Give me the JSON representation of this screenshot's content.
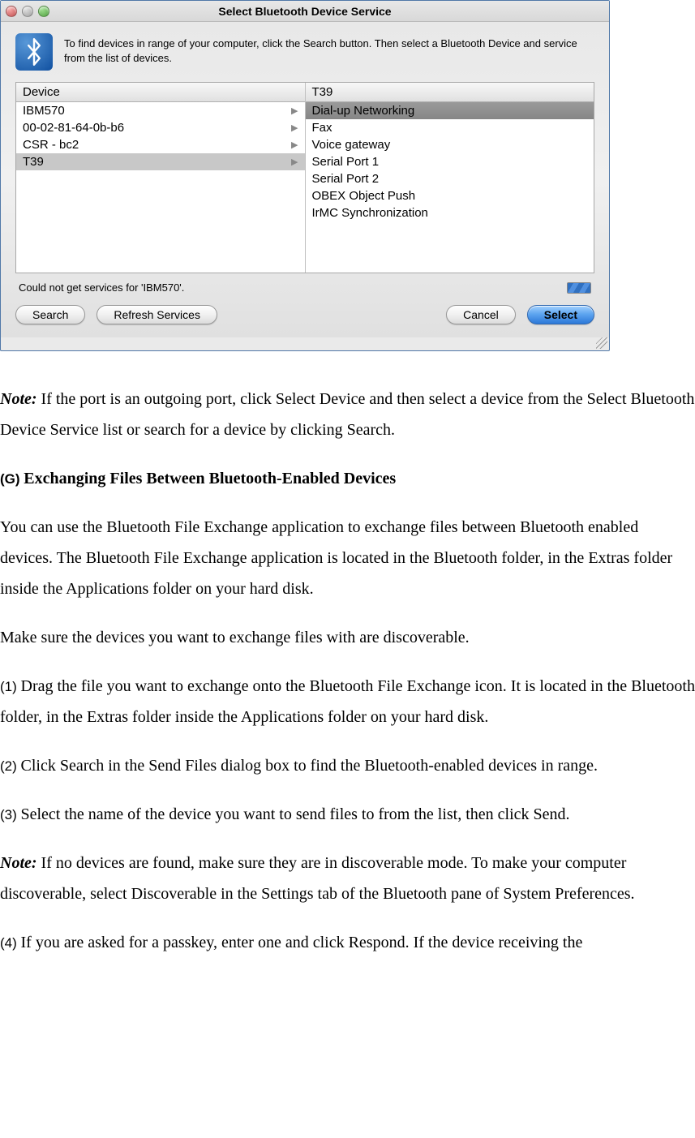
{
  "window": {
    "title": "Select Bluetooth Device Service",
    "instruction": "To find devices in range of your computer, click the Search button. Then select a Bluetooth Device and service from the list of devices.",
    "left_header": "Device",
    "right_header": "T39",
    "devices": [
      {
        "name": "IBM570",
        "selected": false
      },
      {
        "name": "00-02-81-64-0b-b6",
        "selected": false
      },
      {
        "name": "CSR - bc2",
        "selected": false
      },
      {
        "name": "T39",
        "selected": true
      }
    ],
    "services": [
      {
        "name": "Dial-up Networking",
        "selected": true
      },
      {
        "name": "Fax",
        "selected": false
      },
      {
        "name": "Voice gateway",
        "selected": false
      },
      {
        "name": "Serial Port 1",
        "selected": false
      },
      {
        "name": "Serial Port 2",
        "selected": false
      },
      {
        "name": "OBEX Object Push",
        "selected": false
      },
      {
        "name": "IrMC Synchronization",
        "selected": false
      }
    ],
    "status": "Could not get services for 'IBM570'.",
    "buttons": {
      "search": "Search",
      "refresh": "Refresh Services",
      "cancel": "Cancel",
      "select": "Select"
    }
  },
  "doc": {
    "note_label": "Note:",
    "note1_rest": " If the port is an outgoing port, click Select Device and then select a device from the Select Bluetooth Device Service list or search for a device by clicking Search.",
    "g_marker": "(G) ",
    "g_title": "Exchanging Files Between Bluetooth-Enabled Devices",
    "p1": "You can use the Bluetooth File Exchange application to exchange files between Bluetooth enabled devices. The Bluetooth File Exchange application is located in the Bluetooth folder, in the Extras folder inside the Applications folder on your hard disk.",
    "p2": "Make sure the devices you want to exchange files with are discoverable.",
    "s1_marker": "(1) ",
    "s1": "Drag the file you want to exchange onto the Bluetooth File Exchange icon. It is located in the Bluetooth folder, in the Extras folder inside the Applications folder on your hard disk.",
    "s2_marker": "(2) ",
    "s2": "Click Search in the Send Files dialog box to find the Bluetooth-enabled devices in range.",
    "s3_marker": "(3) ",
    "s3": "Select the name of the device you want to send files to from the list, then click Send.",
    "note2_rest": " If no devices are found, make sure they are in discoverable mode. To make your computer discoverable, select Discoverable in the Settings tab of the Bluetooth pane of System Preferences.",
    "s4_marker": "(4) ",
    "s4": "If you are asked for a passkey, enter one and click Respond. If the device receiving the"
  }
}
